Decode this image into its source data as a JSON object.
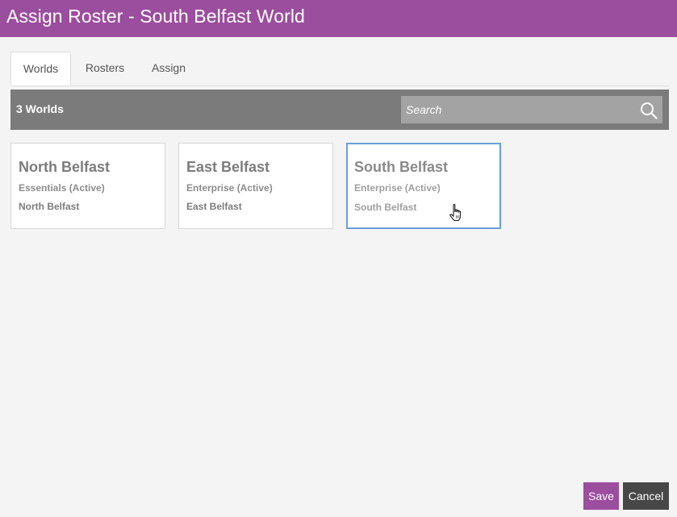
{
  "window": {
    "title": "Assign Roster - South Belfast World"
  },
  "tabs": [
    {
      "label": "Worlds",
      "active": true
    },
    {
      "label": "Rosters",
      "active": false
    },
    {
      "label": "Assign",
      "active": false
    }
  ],
  "toolbar": {
    "count_label": "3 Worlds",
    "search_placeholder": "Search",
    "search_value": ""
  },
  "worlds": [
    {
      "name": "North Belfast",
      "plan": "Essentials (Active)",
      "location": "North Belfast",
      "selected": false
    },
    {
      "name": "East Belfast",
      "plan": "Enterprise (Active)",
      "location": "East Belfast",
      "selected": false
    },
    {
      "name": "South Belfast",
      "plan": "Enterprise (Active)",
      "location": "South Belfast",
      "selected": true
    }
  ],
  "footer": {
    "save_label": "Save",
    "cancel_label": "Cancel"
  },
  "colors": {
    "brand": "#9b4d9e",
    "toolbar": "#7b7b7b",
    "selected_border": "#6a9fd8",
    "cancel": "#474747"
  }
}
